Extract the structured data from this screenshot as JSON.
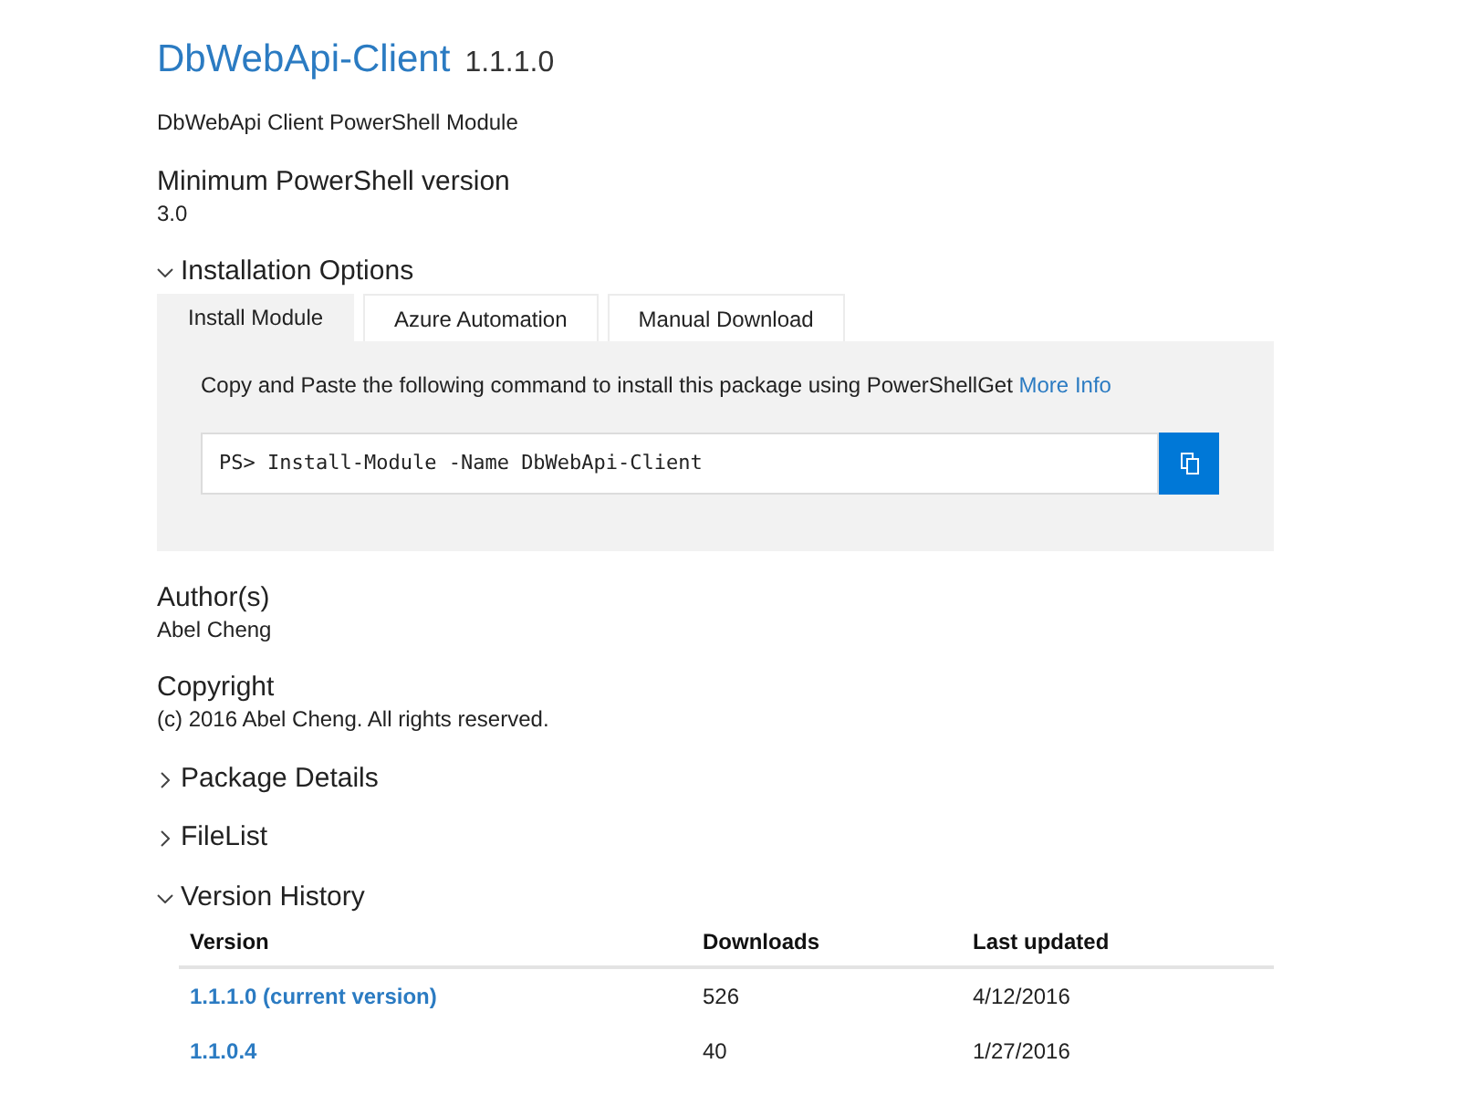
{
  "package": {
    "name": "DbWebApi-Client",
    "version": "1.1.1.0",
    "description": "DbWebApi Client PowerShell Module"
  },
  "min_powershell": {
    "label": "Minimum PowerShell version",
    "value": "3.0"
  },
  "installation": {
    "title": "Installation Options",
    "expanded": true,
    "tabs": [
      {
        "label": "Install Module",
        "selected": true
      },
      {
        "label": "Azure Automation",
        "selected": false
      },
      {
        "label": "Manual Download",
        "selected": false
      }
    ],
    "instruction": "Copy and Paste the following command to install this package using PowerShellGet",
    "more_info": "More Info",
    "command": "PS> Install-Module -Name DbWebApi-Client"
  },
  "authors": {
    "label": "Author(s)",
    "value": "Abel Cheng"
  },
  "copyright": {
    "label": "Copyright",
    "value": "(c) 2016 Abel Cheng. All rights reserved."
  },
  "sections": [
    {
      "title": "Package Details",
      "expanded": false
    },
    {
      "title": "FileList",
      "expanded": false
    }
  ],
  "version_history": {
    "title": "Version History",
    "expanded": true,
    "columns": [
      "Version",
      "Downloads",
      "Last updated"
    ],
    "rows": [
      {
        "version": "1.1.1.0 (current version)",
        "downloads": "526",
        "last_updated": "4/12/2016"
      },
      {
        "version": "1.1.0.4",
        "downloads": "40",
        "last_updated": "1/27/2016"
      }
    ]
  }
}
